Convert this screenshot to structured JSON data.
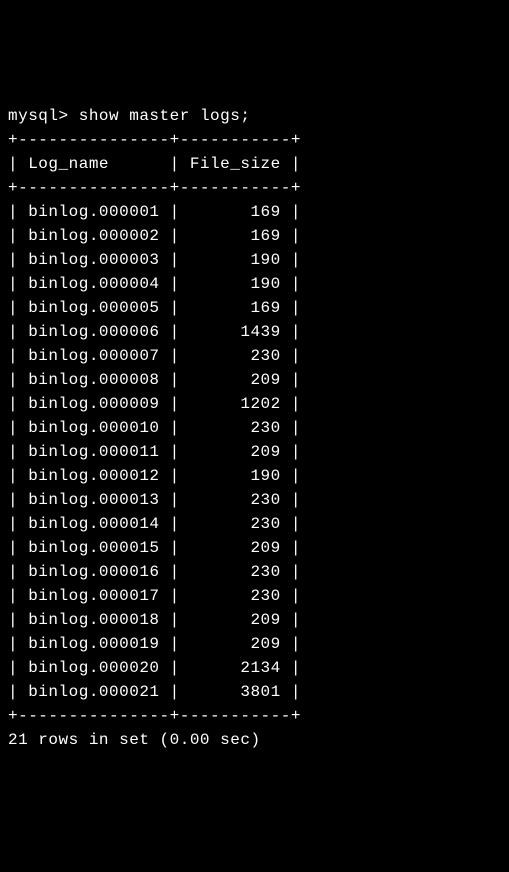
{
  "prompt": "mysql>",
  "command": "show master logs;",
  "columns": [
    "Log_name",
    "File_size"
  ],
  "rows": [
    {
      "log_name": "binlog.000001",
      "file_size": 169
    },
    {
      "log_name": "binlog.000002",
      "file_size": 169
    },
    {
      "log_name": "binlog.000003",
      "file_size": 190
    },
    {
      "log_name": "binlog.000004",
      "file_size": 190
    },
    {
      "log_name": "binlog.000005",
      "file_size": 169
    },
    {
      "log_name": "binlog.000006",
      "file_size": 1439
    },
    {
      "log_name": "binlog.000007",
      "file_size": 230
    },
    {
      "log_name": "binlog.000008",
      "file_size": 209
    },
    {
      "log_name": "binlog.000009",
      "file_size": 1202
    },
    {
      "log_name": "binlog.000010",
      "file_size": 230
    },
    {
      "log_name": "binlog.000011",
      "file_size": 209
    },
    {
      "log_name": "binlog.000012",
      "file_size": 190
    },
    {
      "log_name": "binlog.000013",
      "file_size": 230
    },
    {
      "log_name": "binlog.000014",
      "file_size": 230
    },
    {
      "log_name": "binlog.000015",
      "file_size": 209
    },
    {
      "log_name": "binlog.000016",
      "file_size": 230
    },
    {
      "log_name": "binlog.000017",
      "file_size": 230
    },
    {
      "log_name": "binlog.000018",
      "file_size": 209
    },
    {
      "log_name": "binlog.000019",
      "file_size": 209
    },
    {
      "log_name": "binlog.000020",
      "file_size": 2134
    },
    {
      "log_name": "binlog.000021",
      "file_size": 3801
    }
  ],
  "summary": "21 rows in set (0.00 sec)",
  "col1_width": 15,
  "col2_width": 11
}
